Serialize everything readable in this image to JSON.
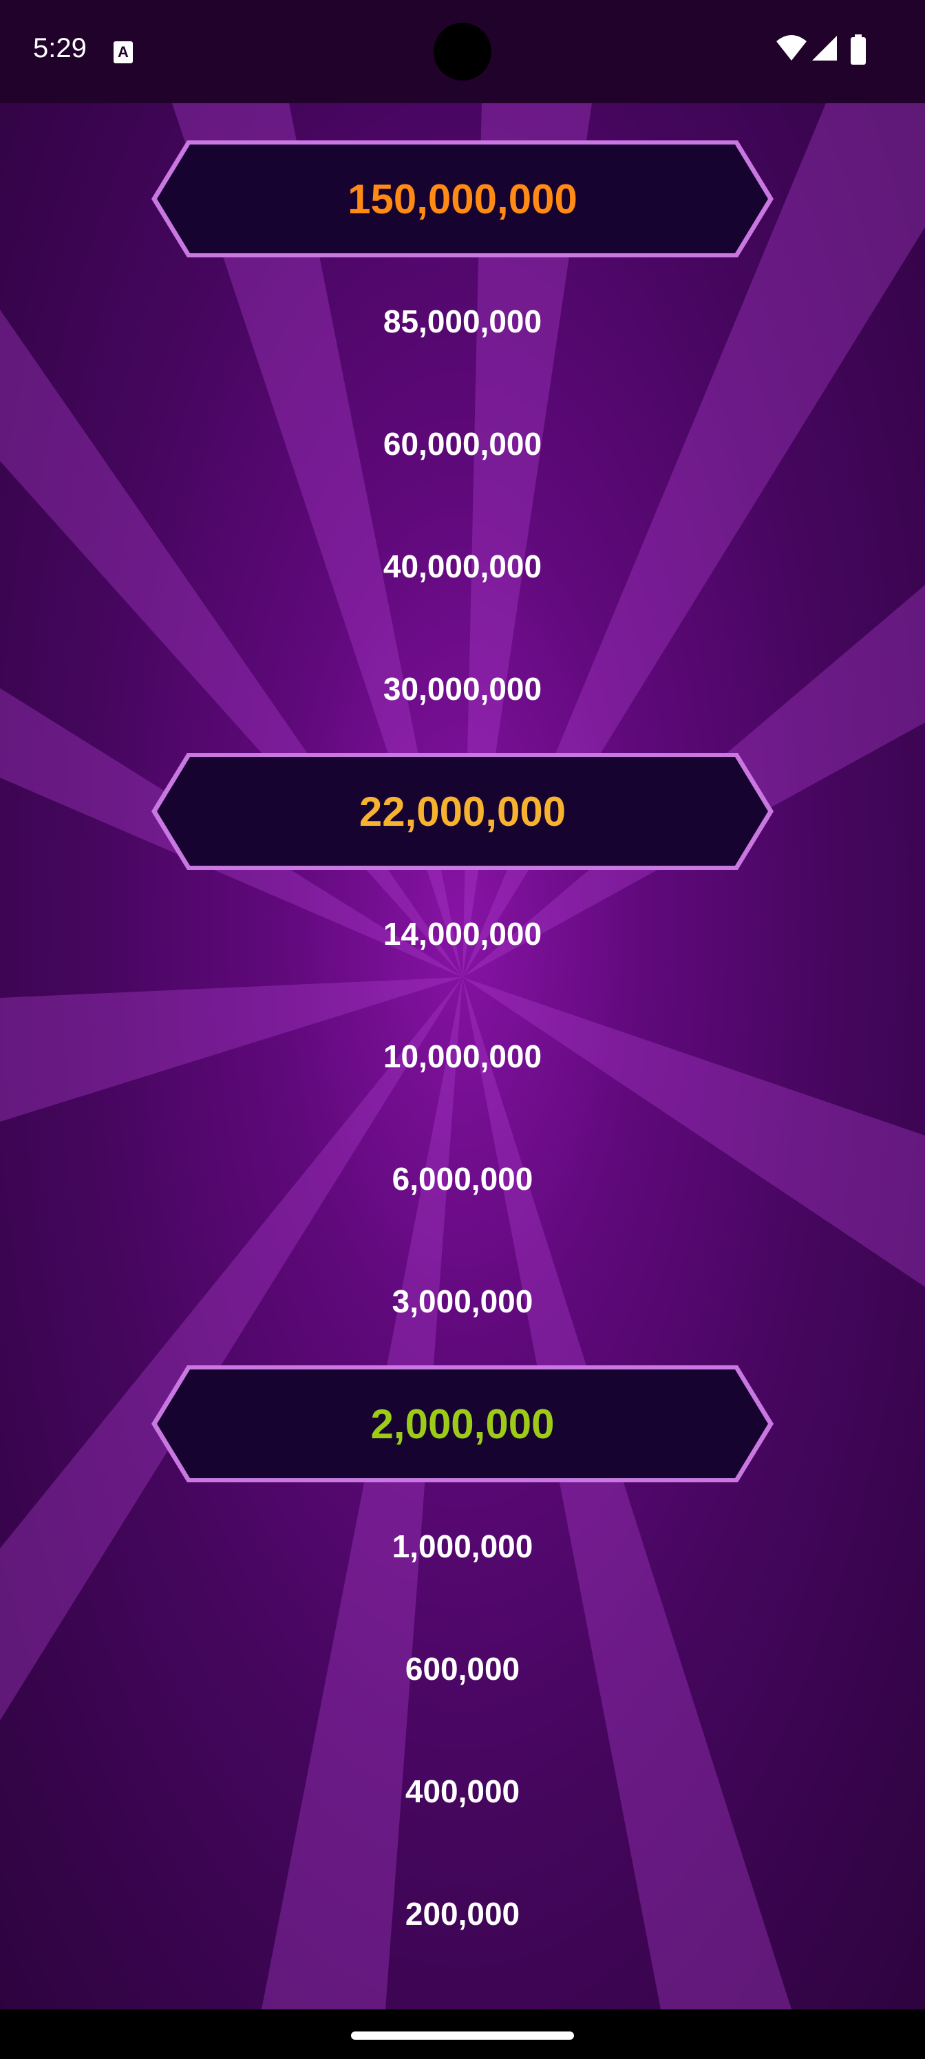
{
  "status_bar": {
    "time": "5:29",
    "a_badge": "A",
    "icons": [
      "wifi-icon",
      "cell-signal-icon",
      "battery-icon"
    ]
  },
  "ladder": {
    "levels": [
      {
        "amount": "150,000,000",
        "milestone": true,
        "color": "#ff8a14"
      },
      {
        "amount": "85,000,000",
        "milestone": false
      },
      {
        "amount": "60,000,000",
        "milestone": false
      },
      {
        "amount": "40,000,000",
        "milestone": false
      },
      {
        "amount": "30,000,000",
        "milestone": false
      },
      {
        "amount": "22,000,000",
        "milestone": true,
        "color": "#f7b330"
      },
      {
        "amount": "14,000,000",
        "milestone": false
      },
      {
        "amount": "10,000,000",
        "milestone": false
      },
      {
        "amount": "6,000,000",
        "milestone": false
      },
      {
        "amount": "3,000,000",
        "milestone": false
      },
      {
        "amount": "2,000,000",
        "milestone": true,
        "color": "#9ccc18"
      },
      {
        "amount": "1,000,000",
        "milestone": false
      },
      {
        "amount": "600,000",
        "milestone": false
      },
      {
        "amount": "400,000",
        "milestone": false
      },
      {
        "amount": "200,000",
        "milestone": false
      }
    ]
  },
  "colors": {
    "plate_fill": "#170330",
    "plate_border": "#c878e0",
    "fab": "#5a0fe8"
  },
  "fab": {
    "icon": "corner-icon"
  }
}
